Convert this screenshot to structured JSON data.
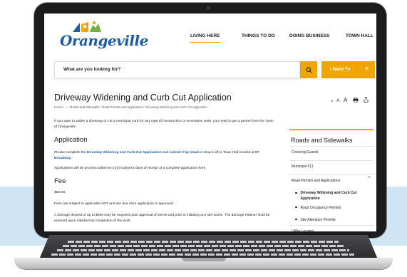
{
  "site": {
    "logo_text": "Orangeville",
    "nav": [
      "LIVING HERE",
      "THINGS TO DO",
      "DOING BUSINESS",
      "TOWN HALL"
    ],
    "search_placeholder": "What are you looking for?",
    "iwant_label": "I Want To"
  },
  "page": {
    "title": "Driveway Widening and Curb Cut Application",
    "breadcrumb": "Home  /  ...  /  Roads and Sidewalks  /  Road Permits and Applications  /  Driveway Widening and Curb Cut Application",
    "tools": [
      "A",
      "A",
      "A"
    ],
    "intro": "If you want to widen a driveway or cut a municipal curb for any type of construction or renovation work, you need to get a permit from the Town of Orangeville.",
    "application_heading": "Application",
    "app_p1_pre": "Please complete the ",
    "app_p1_link1": "Driveway Widening and Curb Cut Application",
    "app_p1_mid": " and ",
    "app_p1_link2": "submit it by email",
    "app_p1_post": " or drop it off to Town Hall located at ",
    "app_p1_link3": "87 Broadway",
    "app_p1_end": ".",
    "app_p2": "Applications will be process within ten (10) business days of receipt of a complete application form.",
    "fee_heading": "Fee",
    "fee_amount": "$50.00",
    "fee_p1": "Fees are subject to applicable HST and are due once application is approved.",
    "fee_p2": "A damage deposit of up to $500 may be required upon approval of permit and prior to initiating any site works. The damage retainer shall be returned upon satisfactory completion of the work."
  },
  "sidebar": {
    "title": "Roads and Sidewalks",
    "items": [
      "Crossing Guards",
      "Municipal 511",
      "Road Permits and Applications"
    ],
    "expand_symbol": "−",
    "subitems": [
      "Driveway Widening and Curb Cut Application",
      "Road Occupancy Permits",
      "Site Alteration Permits"
    ],
    "last_item": "Utility Locates"
  },
  "colors": {
    "accent": "#f0a500",
    "brand_blue": "#1e5aa0"
  },
  "icons": [
    "search-icon",
    "print-icon",
    "share-icon",
    "plus-icon"
  ]
}
